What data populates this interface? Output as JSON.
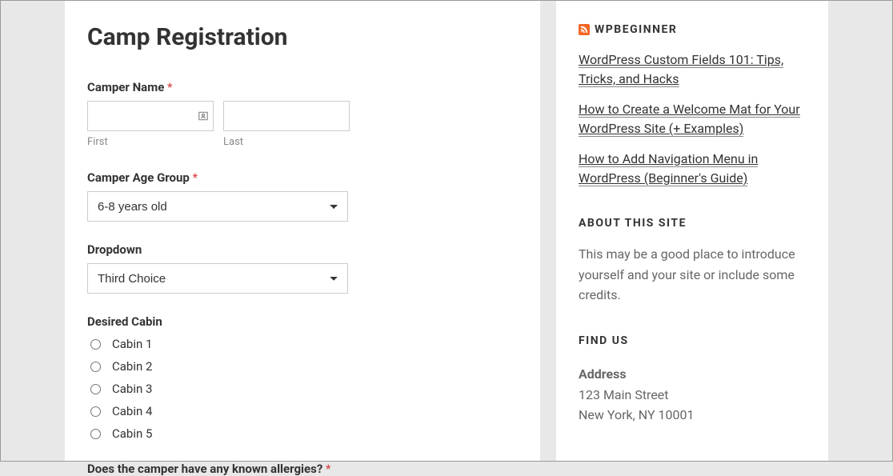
{
  "form": {
    "title": "Camp Registration",
    "camper_name": {
      "label": "Camper Name",
      "required_mark": "*",
      "first_sublabel": "First",
      "last_sublabel": "Last"
    },
    "age_group": {
      "label": "Camper Age Group",
      "required_mark": "*",
      "selected": "6-8 years old"
    },
    "dropdown": {
      "label": "Dropdown",
      "selected": "Third Choice"
    },
    "cabin": {
      "label": "Desired Cabin",
      "options": [
        "Cabin 1",
        "Cabin 2",
        "Cabin 3",
        "Cabin 4",
        "Cabin 5"
      ]
    },
    "allergies": {
      "label": "Does the camper have any known allergies?",
      "required_mark": "*"
    }
  },
  "sidebar": {
    "feed_title": "WPBEGINNER",
    "feed_items": [
      "WordPress Custom Fields 101: Tips, Tricks, and Hacks",
      "How to Create a Welcome Mat for Your WordPress Site (+ Examples)",
      "How to Add Navigation Menu in WordPress (Beginner's Guide)"
    ],
    "about_title": "ABOUT THIS SITE",
    "about_text": "This may be a good place to introduce yourself and your site or include some credits.",
    "find_title": "FIND US",
    "address_label": "Address",
    "address_line1": "123 Main Street",
    "address_line2": "New York, NY 10001"
  }
}
